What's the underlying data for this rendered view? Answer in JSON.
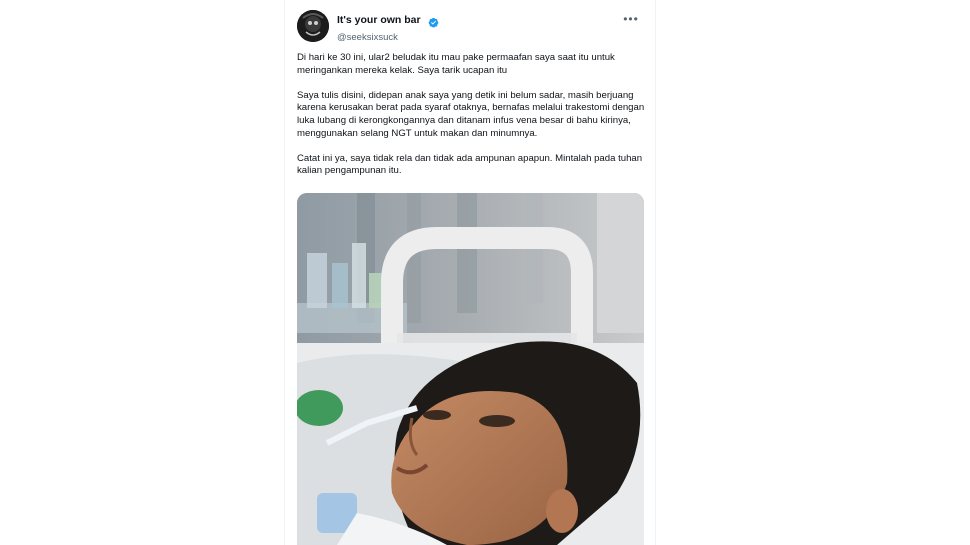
{
  "tweet": {
    "display_name": "It's your own bar",
    "handle": "@seeksixsuck",
    "more_icon": "more-horizontal-icon",
    "verified_icon": "verified-badge-icon",
    "accent_color": "#1d9bf0",
    "paragraphs": [
      "Di hari ke 30 ini, ular2 beludak itu mau pake permaafan saya saat itu untuk meringankan mereka kelak. Saya tarik ucapan itu",
      "Saya tulis disini, didepan anak saya yang detik ini belum sadar, masih berjuang karena kerusakan berat pada syaraf otaknya, bernafas melalui trakestomi dengan luka lubang di kerongkongannya dan ditanam infus vena besar di bahu kirinya, menggunakan selang NGT untuk makan dan minumnya.",
      "Catat ini ya, saya tidak rela dan tidak ada ampunan apapun. Mintalah pada tuhan kalian pengampunan itu."
    ]
  }
}
